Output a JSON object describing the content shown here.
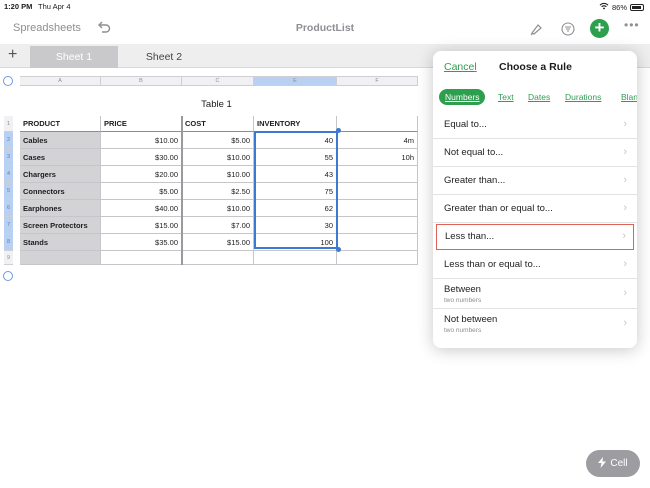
{
  "status": {
    "time": "1:20 PM",
    "date": "Thu Apr 4",
    "battery": "86%"
  },
  "toolbar": {
    "back_label": "Spreadsheets",
    "title": "ProductList"
  },
  "tabs": [
    {
      "label": "Sheet 1",
      "active": true
    },
    {
      "label": "Sheet 2",
      "active": false
    }
  ],
  "columns": [
    "A",
    "B",
    "C",
    "E",
    "F"
  ],
  "rows": [
    "1",
    "2",
    "3",
    "4",
    "5",
    "6",
    "7",
    "8",
    "9"
  ],
  "table": {
    "title": "Table 1",
    "headers": [
      "PRODUCT",
      "PRICE",
      "COST",
      "INVENTORY"
    ],
    "rows": [
      {
        "product": "Cables",
        "price": "$10.00",
        "cost": "$5.00",
        "inventory": "40",
        "extra": "4m"
      },
      {
        "product": "Cases",
        "price": "$30.00",
        "cost": "$10.00",
        "inventory": "55",
        "extra": "10h"
      },
      {
        "product": "Chargers",
        "price": "$20.00",
        "cost": "$10.00",
        "inventory": "43",
        "extra": ""
      },
      {
        "product": "Connectors",
        "price": "$5.00",
        "cost": "$2.50",
        "inventory": "75",
        "extra": ""
      },
      {
        "product": "Earphones",
        "price": "$40.00",
        "cost": "$10.00",
        "inventory": "62",
        "extra": ""
      },
      {
        "product": "Screen Protectors",
        "price": "$15.00",
        "cost": "$7.00",
        "inventory": "30",
        "extra": ""
      },
      {
        "product": "Stands",
        "price": "$35.00",
        "cost": "$15.00",
        "inventory": "100",
        "extra": ""
      }
    ]
  },
  "popover": {
    "cancel_label": "Cancel",
    "title": "Choose a Rule",
    "segments": [
      {
        "label": "Numbers",
        "active": true
      },
      {
        "label": "Text",
        "active": false
      },
      {
        "label": "Dates",
        "active": false
      },
      {
        "label": "Durations",
        "active": false
      },
      {
        "label": "Blan",
        "active": false
      }
    ],
    "rules": [
      {
        "label": "Equal to...",
        "sub": ""
      },
      {
        "label": "Not equal to...",
        "sub": ""
      },
      {
        "label": "Greater than...",
        "sub": ""
      },
      {
        "label": "Greater than or equal to...",
        "sub": ""
      },
      {
        "label": "Less than...",
        "sub": "",
        "highlighted": true
      },
      {
        "label": "Less than or equal to...",
        "sub": ""
      },
      {
        "label": "Between",
        "sub": "two numbers"
      },
      {
        "label": "Not between",
        "sub": "two numbers"
      }
    ]
  },
  "cell_button": {
    "label": "Cell"
  },
  "colors": {
    "accent": "#2e9e4f",
    "selection": "#3b7ad0",
    "highlight_border": "#e0605a"
  }
}
